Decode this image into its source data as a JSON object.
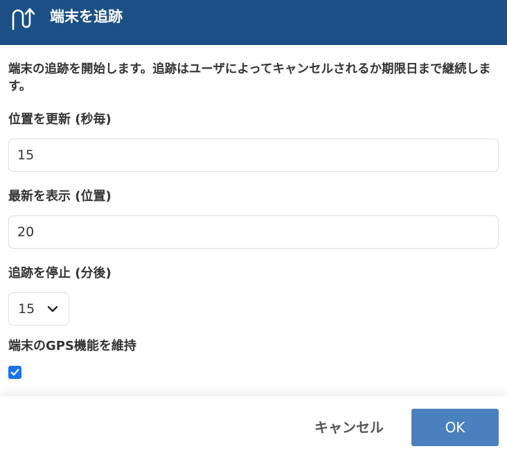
{
  "header": {
    "title": "端末を追跡",
    "icon": "u-turn-arrow-icon",
    "background_color": "#1b4f86"
  },
  "description": "端末の追跡を開始します。追跡はユーザによってキャンセルされるか期限日まで継続します。",
  "fields": {
    "update_interval": {
      "label": "位置を更新 (秒毎)",
      "value": "15"
    },
    "show_latest": {
      "label": "最新を表示 (位置)",
      "value": "20"
    },
    "stop_tracking": {
      "label": "追跡を停止 (分後)",
      "selected": "15"
    },
    "keep_gps": {
      "label": "端末のGPS機能を維持",
      "checked": true
    }
  },
  "footer": {
    "cancel_label": "キャンセル",
    "ok_label": "OK",
    "ok_color": "#4a80bd"
  }
}
